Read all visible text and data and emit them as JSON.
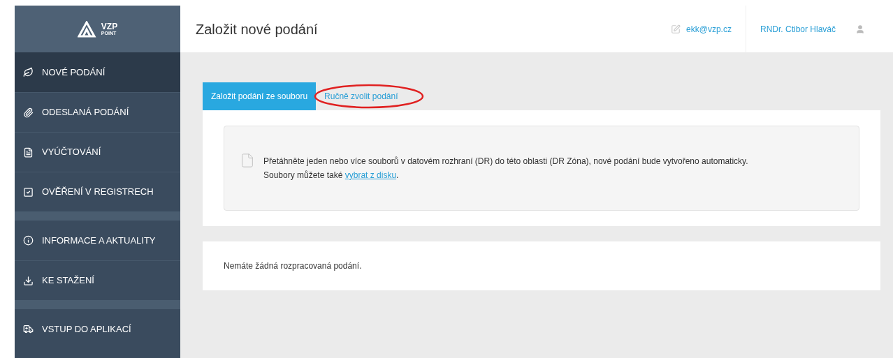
{
  "header": {
    "title": "Založit nové podání",
    "email": "ekk@vzp.cz",
    "user": "RNDr. Ctibor Hlaváč"
  },
  "logo": {
    "line1": "VZP",
    "line2": "POINT"
  },
  "sidebar": {
    "groups": [
      {
        "items": [
          {
            "label": "NOVÉ PODÁNÍ",
            "kind": "leaf",
            "selected": true
          },
          {
            "label": "ODESLANÁ PODÁNÍ",
            "kind": "paperclip",
            "selected": false
          },
          {
            "label": "VYÚČTOVÁNÍ",
            "kind": "document",
            "selected": false
          },
          {
            "label": "OVĚŘENÍ V REGISTRECH",
            "kind": "checkbox",
            "selected": false
          }
        ]
      },
      {
        "items": [
          {
            "label": "INFORMACE A AKTUALITY",
            "kind": "info",
            "selected": false
          },
          {
            "label": "KE STAŽENÍ",
            "kind": "download",
            "selected": false
          }
        ]
      },
      {
        "items": [
          {
            "label": "VSTUP DO APLIKACÍ",
            "kind": "ambulance",
            "selected": false
          }
        ]
      }
    ]
  },
  "tabs": [
    {
      "label": "Založit podání ze souboru",
      "selected": true,
      "circled": false
    },
    {
      "label": "Ručně zvolit podání",
      "selected": false,
      "circled": true
    }
  ],
  "dropzone": {
    "text": "Přetáhněte jeden nebo více souborů v datovém rozhraní (DR) do této oblasti (DR Zóna), nové podání bude vytvořeno automaticky.",
    "text2": "Soubory můžete také",
    "link": "vybrat z disku",
    "after": "."
  },
  "drafts": {
    "message": "Nemáte žádná rozpracovaná podání."
  }
}
